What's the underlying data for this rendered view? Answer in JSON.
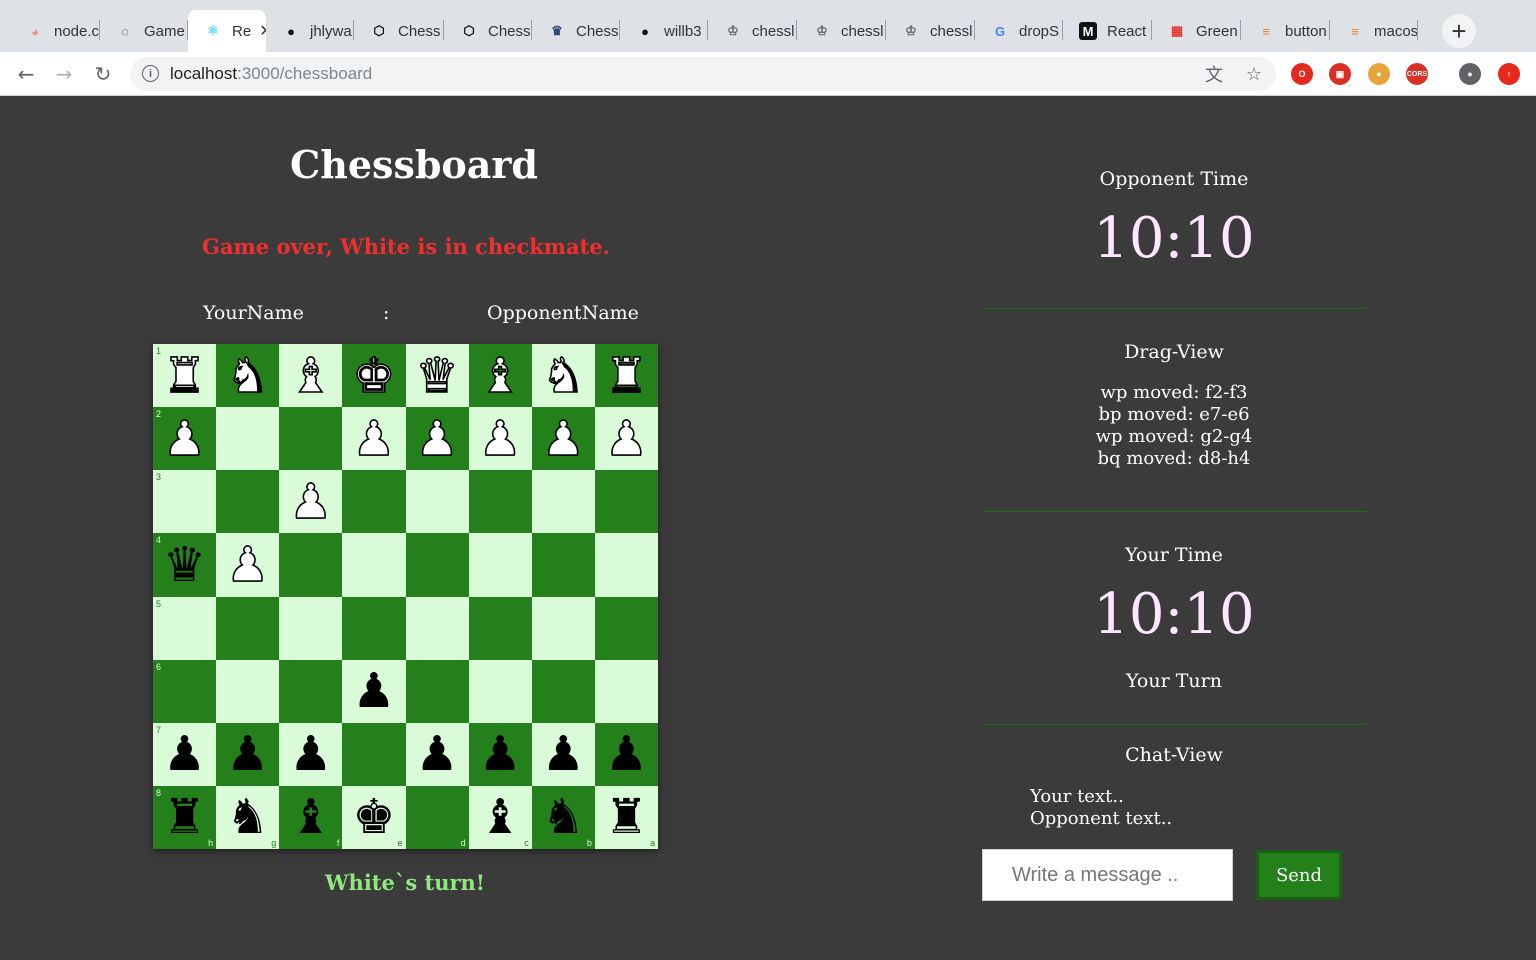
{
  "browser": {
    "tabs": [
      {
        "label": "node.c",
        "icon": "node-icon",
        "fav": "◕",
        "favColor": "#ff8a80"
      },
      {
        "label": "Game",
        "icon": "codesandbox-icon",
        "fav": "◌",
        "favColor": "#222"
      },
      {
        "label": "Re",
        "icon": "react-icon",
        "fav": "⚛",
        "favColor": "#61dafb",
        "active": true
      },
      {
        "label": "jhlywa",
        "icon": "github-icon",
        "fav": "●",
        "favColor": "#111"
      },
      {
        "label": "Chess",
        "icon": "codepen-icon",
        "fav": "⬡",
        "favColor": "#111"
      },
      {
        "label": "Chess",
        "icon": "codesandbox-icon",
        "fav": "⬡",
        "favColor": "#111"
      },
      {
        "label": "Chess",
        "icon": "chess-crown-icon",
        "fav": "♛",
        "favColor": "#2d4a7a"
      },
      {
        "label": "willb3",
        "icon": "github-icon",
        "fav": "●",
        "favColor": "#111"
      },
      {
        "label": "chessl",
        "icon": "chess-king-icon",
        "fav": "♔",
        "favColor": "#666"
      },
      {
        "label": "chessl",
        "icon": "chess-king-icon",
        "fav": "♔",
        "favColor": "#666"
      },
      {
        "label": "chessl",
        "icon": "chess-king-icon",
        "fav": "♔",
        "favColor": "#666"
      },
      {
        "label": "dropS",
        "icon": "google-icon",
        "fav": "G",
        "favColor": "#4285f4"
      },
      {
        "label": "React",
        "icon": "medium-icon",
        "fav": "M",
        "favColor": "#fff",
        "favBg": "#111"
      },
      {
        "label": "Green",
        "icon": "color-grid-icon",
        "fav": "▦",
        "favColor": "#e53935"
      },
      {
        "label": "button",
        "icon": "stackoverflow-icon",
        "fav": "≡",
        "favColor": "#f48024"
      },
      {
        "label": "macos",
        "icon": "stackoverflow-icon",
        "fav": "≡",
        "favColor": "#f48024"
      }
    ],
    "newtab_glyph": "+",
    "close_glyph": "✕",
    "url_host": "localhost",
    "url_path": ":3000/chessboard",
    "extensions": [
      {
        "name": "opera-ext-icon",
        "glyph": "O",
        "color": "#e5291f"
      },
      {
        "name": "puzzle-ext-icon",
        "glyph": "▣",
        "color": "#d93025"
      },
      {
        "name": "cookie-ext-icon",
        "glyph": "●",
        "color": "#e8a33c"
      },
      {
        "name": "cors-ext-icon",
        "glyph": "CORS",
        "color": "#d93025"
      },
      {
        "name": "account-icon",
        "glyph": "●",
        "color": "#5f6368"
      },
      {
        "name": "update-icon",
        "glyph": "↑",
        "color": "#e5291f"
      }
    ]
  },
  "page": {
    "title": "Chessboard",
    "status": "Game over, White is in checkmate.",
    "your_name": "YourName",
    "separator": ":",
    "opponent_name": "OpponentName",
    "turn_text": "White`s turn!"
  },
  "board": {
    "ranks": [
      "1",
      "2",
      "3",
      "4",
      "5",
      "6",
      "7",
      "8"
    ],
    "files": [
      "h",
      "g",
      "f",
      "e",
      "d",
      "c",
      "b",
      "a"
    ],
    "rows": [
      [
        "wr",
        "wn",
        "wb",
        "wk",
        "wq",
        "wb",
        "wn",
        "wr"
      ],
      [
        "wp",
        "",
        "",
        "wp",
        "wp",
        "wp",
        "wp",
        "wp"
      ],
      [
        "",
        "",
        "wp",
        "",
        "",
        "",
        "",
        ""
      ],
      [
        "bq",
        "wp",
        "",
        "",
        "",
        "",
        "",
        ""
      ],
      [
        "",
        "",
        "",
        "",
        "",
        "",
        "",
        ""
      ],
      [
        "",
        "",
        "",
        "bp",
        "",
        "",
        "",
        ""
      ],
      [
        "bp",
        "bp",
        "bp",
        "",
        "bp",
        "bp",
        "bp",
        "bp"
      ],
      [
        "br",
        "bn",
        "bb",
        "bk",
        "",
        "bb",
        "bn",
        "br"
      ]
    ],
    "glyphs": {
      "k": "♚",
      "q": "♛",
      "r": "♜",
      "b": "♝",
      "n": "♞",
      "p": "♟"
    },
    "colors": {
      "light": "#d9fbd8",
      "dark": "#24801a"
    }
  },
  "panel": {
    "opponent_time_label": "Opponent Time",
    "opponent_time": "10:10",
    "drag_view_label": "Drag-View",
    "moves": [
      "wp moved: f2-f3",
      "bp moved: e7-e6",
      "wp moved: g2-g4",
      "bq moved: d8-h4"
    ],
    "your_time_label": "Your Time",
    "your_time": "10:10",
    "your_turn_label": "Your Turn",
    "chat_view_label": "Chat-View",
    "chat_lines": [
      "Your text..",
      "Opponent text.."
    ],
    "message_placeholder": "Write a message ..",
    "send_label": "Send"
  }
}
